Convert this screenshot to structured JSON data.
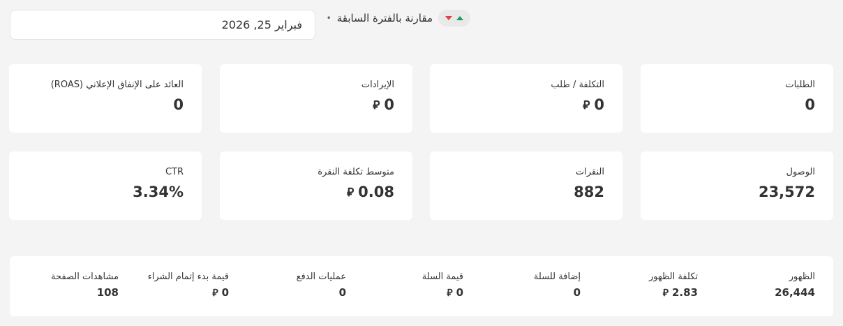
{
  "header": {
    "compare_label": "مقارنة بالفترة السابقة",
    "separator": "•",
    "date": "فبراير 25, 2026"
  },
  "currency_symbol": "⃁",
  "cards_row1": [
    {
      "label": "الطلبات",
      "value": "0",
      "currency": false
    },
    {
      "label": "التكلفة / طلب",
      "value": "0",
      "currency": true
    },
    {
      "label": "الإيرادات",
      "value": "0",
      "currency": true
    },
    {
      "label": "العائد على الإنفاق الإعلاني (ROAS)",
      "value": "0",
      "currency": false
    }
  ],
  "cards_row2": [
    {
      "label": "الوصول",
      "value": "23,572",
      "currency": false
    },
    {
      "label": "النقرات",
      "value": "882",
      "currency": false
    },
    {
      "label": "متوسط تكلفة النقرة",
      "value": "0.08",
      "currency": true
    },
    {
      "label": "CTR",
      "value": "3.34%",
      "currency": false
    }
  ],
  "strip": [
    {
      "label": "الظهور",
      "value": "26,444",
      "currency": false
    },
    {
      "label": "تكلفة الظهور",
      "value": "2.83",
      "currency": true
    },
    {
      "label": "إضافة للسلة",
      "value": "0",
      "currency": false
    },
    {
      "label": "قيمة السلة",
      "value": "0",
      "currency": true
    },
    {
      "label": "عمليات الدفع",
      "value": "0",
      "currency": false
    },
    {
      "label": "قيمة بدء إتمام الشراء",
      "value": "0",
      "currency": true
    },
    {
      "label": "مشاهدات الصفحة",
      "value": "108",
      "currency": false
    }
  ],
  "colors": {
    "up": "#1b9c5a",
    "down": "#e0404a"
  }
}
